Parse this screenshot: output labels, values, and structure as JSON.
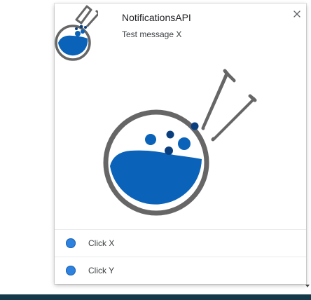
{
  "notification": {
    "title": "NotificationsAPI",
    "message": "Test message X",
    "close_icon": "close-icon",
    "icon": "flask-icon",
    "image": "flask-image"
  },
  "actions": [
    {
      "label": "Click X",
      "icon": "blue-circle-icon"
    },
    {
      "label": "Click Y",
      "icon": "blue-circle-icon"
    }
  ],
  "colors": {
    "flask_outline": "#666666",
    "flask_liquid": "#0a63b8",
    "bubble_dark": "#0a3f7f",
    "action_dot": "#2d82e0",
    "taskbar": "#143a4a"
  }
}
